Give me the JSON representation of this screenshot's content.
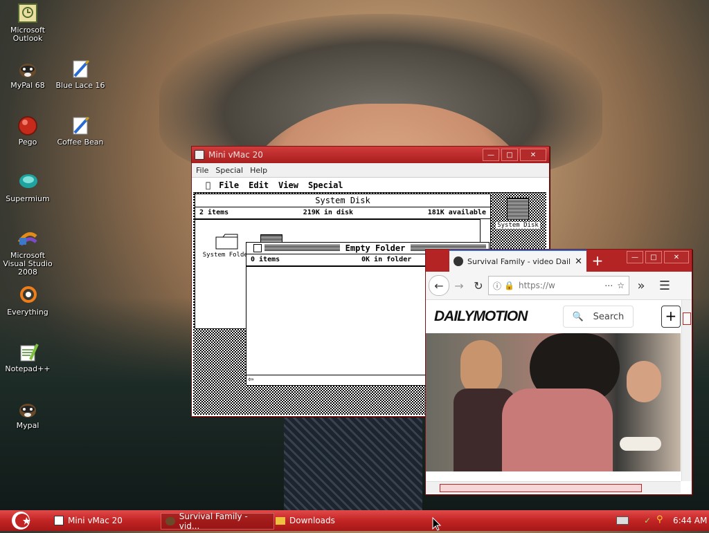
{
  "desktop": {
    "icons": [
      {
        "label": "Microsoft Outlook",
        "icon": "outlook-icon"
      },
      {
        "label": "MyPal 68",
        "icon": "mypal-icon"
      },
      {
        "label": "Blue Lace 16",
        "icon": "blue-lace-icon"
      },
      {
        "label": "Pego",
        "icon": "pego-icon"
      },
      {
        "label": "Coffee Bean",
        "icon": "coffee-bean-icon"
      },
      {
        "label": "Supermium",
        "icon": "supermium-icon"
      },
      {
        "label": "Microsoft Visual Studio 2008",
        "icon": "visual-studio-icon"
      },
      {
        "label": "Everything",
        "icon": "everything-icon"
      },
      {
        "label": "Notepad++",
        "icon": "notepadpp-icon"
      },
      {
        "label": "Mypal",
        "icon": "mypal-icon"
      }
    ]
  },
  "minivmac": {
    "title": "Mini vMac 20",
    "menu": [
      "File",
      "Special",
      "Help"
    ],
    "mac_menu": [
      "File",
      "Edit",
      "View",
      "Special"
    ],
    "system_disk": {
      "title": "System Disk",
      "items": "2 items",
      "in_disk": "219K in disk",
      "available": "181K available",
      "folder_label": "System Folder",
      "desktop_label": "System Disk"
    },
    "empty_folder": {
      "title": "Empty Folder",
      "items": "0 items",
      "in_folder": "0K in folder"
    }
  },
  "browser": {
    "tab_title": "Survival Family - video Dail",
    "url": "https://w",
    "logo": "DAILYMOTION",
    "search_label": "Search",
    "plus": "+"
  },
  "taskbar": {
    "items": [
      "Mini vMac 20",
      "Survival Family - vid...",
      "Downloads"
    ],
    "clock": "6:44 AM"
  },
  "colors": {
    "accent": "#c32424",
    "titlebar": "#a81e1e"
  }
}
